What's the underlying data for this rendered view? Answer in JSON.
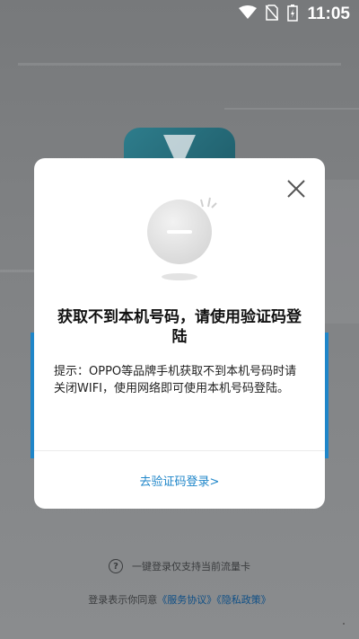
{
  "status_bar": {
    "time": "11:05",
    "icons": [
      "wifi-icon",
      "no-sim-icon",
      "battery-charging-icon"
    ]
  },
  "background": {
    "one_tap_note": "一键登录仅支持当前流量卡",
    "agreement_prefix": "登录表示你同意",
    "service_agreement": "《服务协议》",
    "privacy_policy": "《隐私政策》"
  },
  "dialog": {
    "title": "获取不到本机号码，请使用验证码登陆",
    "tip": "提示：OPPO等品牌手机获取不到本机号码时请关闭WIFI，使用网络即可使用本机号码登陆。",
    "action_label": "去验证码登录>",
    "close_icon": "close-icon",
    "illustration_icon": "no-number-icon"
  },
  "colors": {
    "accent": "#1f86c9",
    "link_dark": "#0f4f86",
    "dim_overlay": "#7d7f81"
  }
}
